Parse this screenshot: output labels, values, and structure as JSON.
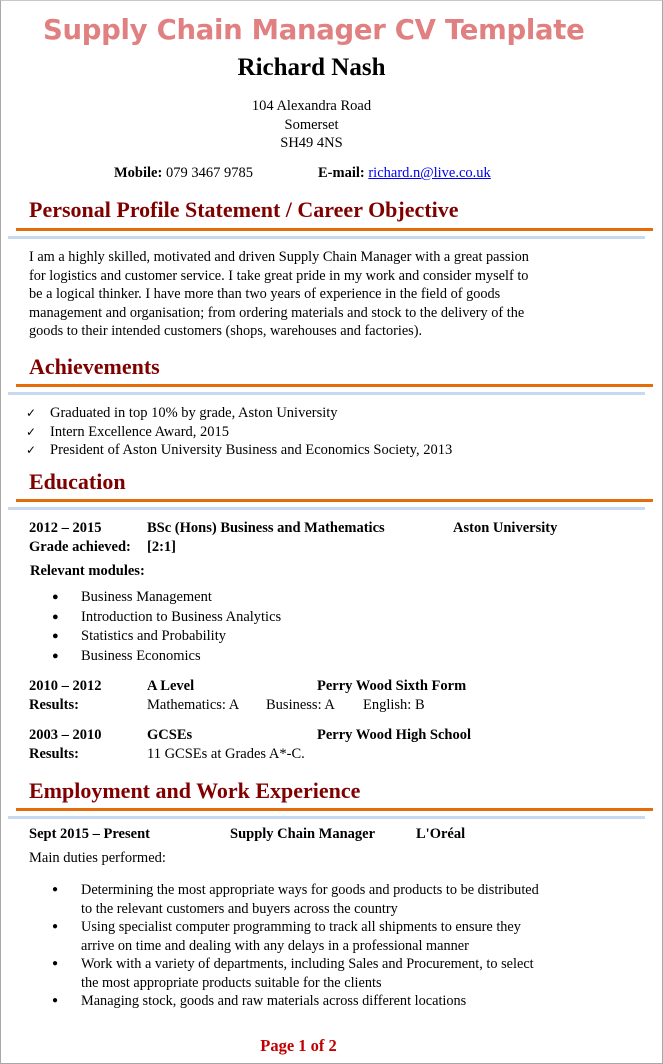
{
  "document": {
    "title": "Supply Chain Manager CV Template",
    "name": "Richard Nash",
    "address": [
      "104 Alexandra Road",
      "Somerset",
      "SH49 4NS"
    ],
    "contact": {
      "mobile_label": "Mobile:",
      "mobile": "079 3467 9785",
      "email_label": "E-mail:",
      "email": "richard.n@live.co.uk"
    },
    "colors": {
      "template_title": "#e08080",
      "section_heading": "#800000",
      "rule_orange": "#e46c0a",
      "rule_blue": "#c6d9f1",
      "page_number": "#c00000",
      "link": "#0000ee"
    }
  },
  "profile": {
    "heading": "Personal Profile Statement / Career Objective",
    "lines": [
      "I am a highly skilled, motivated and driven Supply Chain Manager with a great passion",
      "for logistics and customer service. I take great pride in my work and consider myself to",
      "be a logical thinker. I have more than two years of experience in the field of goods",
      "management and organisation; from ordering materials and stock to the delivery of the",
      "goods to their intended customers (shops, warehouses and factories)."
    ]
  },
  "achievements": {
    "heading": "Achievements",
    "items": [
      "Graduated in top 10% by grade, Aston University",
      "Intern Excellence Award, 2015",
      "President of Aston University Business and Economics Society, 2013"
    ]
  },
  "education": {
    "heading": "Education",
    "degree": {
      "dates": "2012 – 2015",
      "qualification": "BSc (Hons) Business and Mathematics",
      "institution": "Aston University",
      "grade_label": "Grade achieved:",
      "grade": "[2:1]",
      "modules_label": "Relevant modules:",
      "modules": [
        "Business Management",
        "Introduction to Business Analytics",
        "Statistics and Probability",
        "Business Economics"
      ]
    },
    "alevel": {
      "dates": "2010 – 2012",
      "qualification": "A Level",
      "institution": "Perry Wood Sixth Form",
      "results_label": "Results:",
      "results": [
        "Mathematics: A",
        "Business: A",
        "English: B"
      ]
    },
    "gcse": {
      "dates": "2003 – 2010",
      "qualification": "GCSEs",
      "institution": "Perry Wood High School",
      "results_label": "Results:",
      "results": "11 GCSEs at Grades A*-C."
    }
  },
  "employment": {
    "heading": "Employment and Work Experience",
    "job": {
      "dates": "Sept 2015 – Present",
      "role": "Supply Chain Manager",
      "employer": "L'Oréal",
      "duties_label": "Main duties performed:",
      "duties": [
        [
          "Determining the most appropriate ways for goods and products to be distributed",
          "to the relevant customers and buyers across the country"
        ],
        [
          "Using specialist computer programming to track all shipments to ensure they",
          "arrive on time and dealing with any delays in a professional manner"
        ],
        [
          "Work with a variety of departments, including Sales and Procurement, to select",
          "the most appropriate products suitable for the clients"
        ],
        [
          "Managing stock, goods and raw materials across different locations"
        ]
      ]
    }
  },
  "footer": {
    "page_label": "Page 1 of 2"
  },
  "icons": {
    "check": "✓",
    "bullet": "●"
  }
}
